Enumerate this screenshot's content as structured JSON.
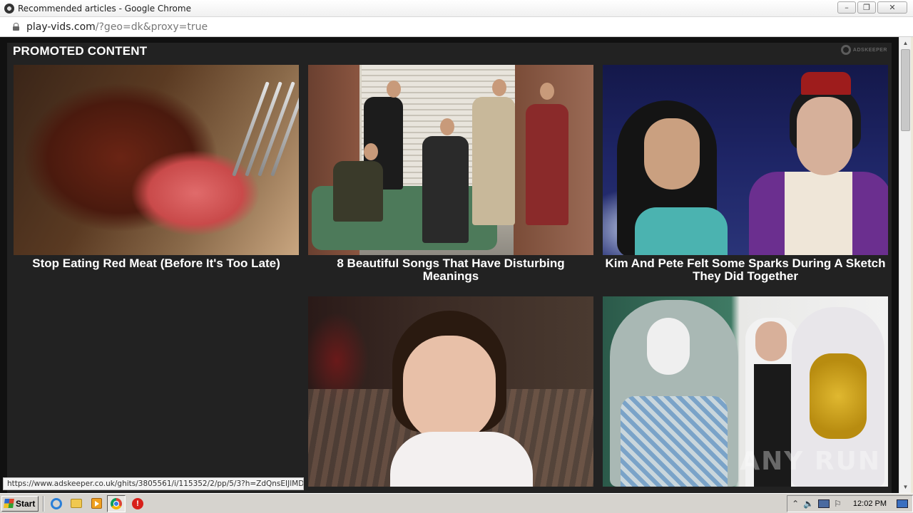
{
  "window": {
    "title": "Recommended articles - Google Chrome",
    "buttons": {
      "minimize": "–",
      "restore": "❐",
      "close": "✕"
    }
  },
  "addressbar": {
    "url_host": "play-vids.com",
    "url_rest": "/?geo=dk&proxy=true"
  },
  "page": {
    "heading": "PROMOTED CONTENT",
    "brand_label": "ADSKEEPER",
    "cards": [
      {
        "title": "Stop Eating Red Meat (Before It's Too Late)",
        "thumb_icon": "steak-image"
      },
      {
        "title": "8 Beautiful Songs That Have Disturbing Meanings",
        "thumb_icon": "band-image"
      },
      {
        "title": "Kim And Pete Felt Some Sparks During A Sketch They Did Together",
        "thumb_icon": "costume-image"
      },
      {
        "title": "",
        "thumb_icon": "child-photo-image"
      },
      {
        "title": "",
        "thumb_icon": "brides-image",
        "watermark": "ANY RUN"
      }
    ]
  },
  "status_url": "https://www.adskeeper.co.uk/ghits/3805561/i/115352/2/pp/5/3?h=ZdQnsEIJlMDjz...",
  "taskbar": {
    "start_label": "Start",
    "clock": "12:02 PM"
  },
  "colors": {
    "page_bg": "#111111",
    "panel_bg": "#222222",
    "title_text": "#ffffff"
  }
}
